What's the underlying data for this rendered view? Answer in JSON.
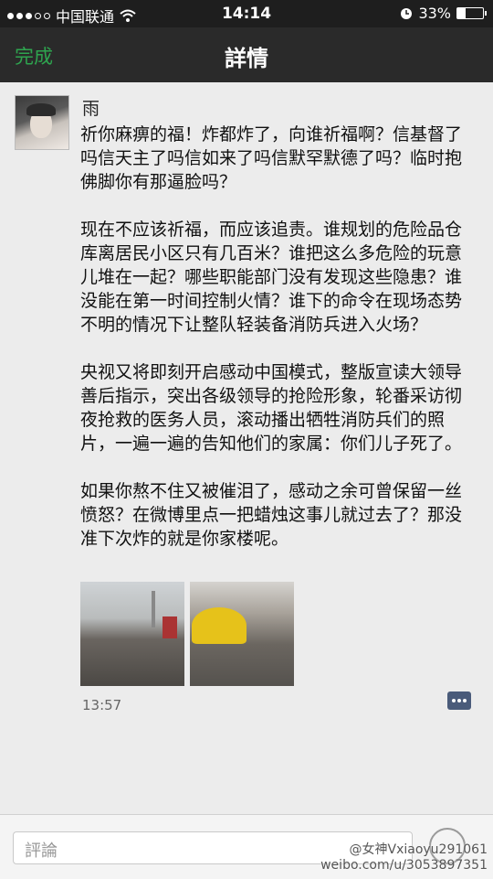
{
  "status_bar": {
    "carrier": "中国联通",
    "time": "14:14",
    "battery": "33%",
    "battery_level": 0.33,
    "icons": [
      "signal-dots-icon",
      "wifi-icon",
      "alarm-icon",
      "battery-icon"
    ]
  },
  "nav": {
    "done_label": "完成",
    "title": "詳情"
  },
  "post": {
    "username": "雨",
    "paragraphs": [
      "祈你麻痹的福！炸都炸了，向谁祈福啊？信基督了吗信天主了吗信如来了吗信默罕默德了吗？临时抱佛脚你有那逼脸吗？",
      "现在不应该祈福，而应该追责。谁规划的危险品仓库离居民小区只有几百米？谁把这么多危险的玩意儿堆在一起？哪些职能部门没有发现这些隐患？谁没能在第一时间控制火情？谁下的命令在现场态势不明的情况下让整队轻装备消防兵进入火场？",
      "央视又将即刻开启感动中国模式，整版宣读大领导善后指示，突出各级领导的抢险形象，轮番采访彻夜抢救的医务人员，滚动播出牺牲消防兵们的照片，一遍一遍的告知他们的家属：你们儿子死了。",
      "如果你熬不住又被催泪了，感动之余可曾保留一丝愤怒？在微博里点一把蜡烛这事儿就过去了？那没准下次炸的就是你家楼呢。"
    ],
    "time": "13:57"
  },
  "bottom": {
    "comment_placeholder": "評論"
  },
  "watermark": {
    "line1": "@女神Vxiaoyu291061",
    "line2": "weibo.com/u/3053897351"
  },
  "colors": {
    "done": "#2ea44f",
    "nav_bg": "#2a2a2a",
    "background": "#ececec"
  }
}
